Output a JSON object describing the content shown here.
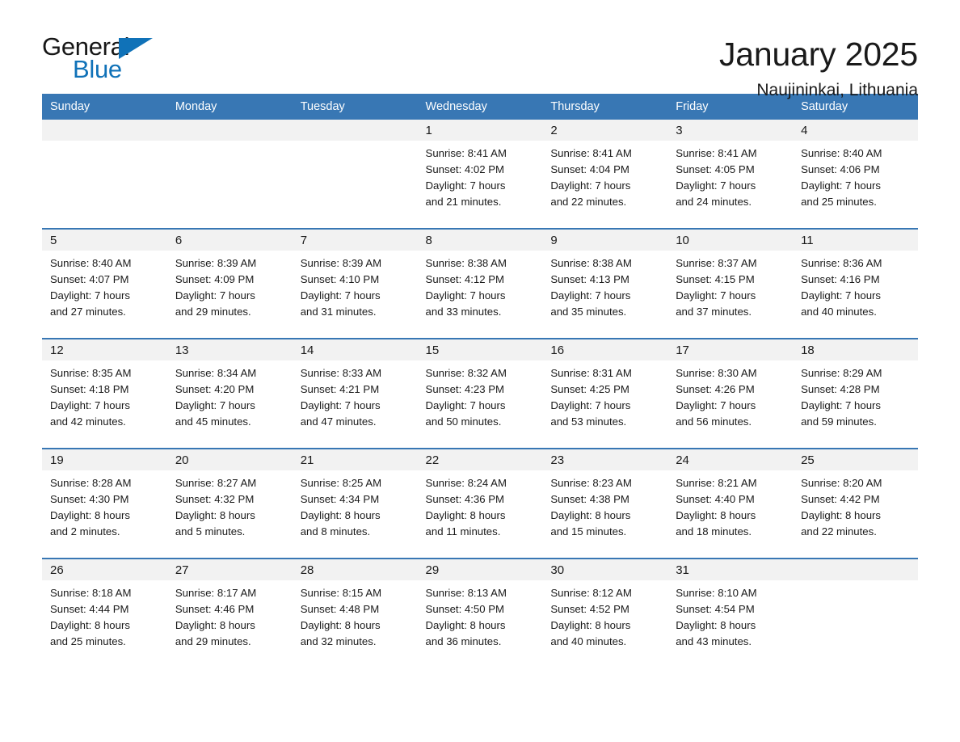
{
  "logo": {
    "word_one": "General",
    "word_two": "Blue",
    "triangle_color": "#1072b8"
  },
  "header": {
    "title": "January 2025",
    "subtitle": "Naujininkai, Lithuania"
  },
  "calendar": {
    "accent_color": "#3877b4",
    "weekday_headers": [
      "Sunday",
      "Monday",
      "Tuesday",
      "Wednesday",
      "Thursday",
      "Friday",
      "Saturday"
    ],
    "weeks": [
      [
        {
          "day": "",
          "lines": []
        },
        {
          "day": "",
          "lines": []
        },
        {
          "day": "",
          "lines": []
        },
        {
          "day": "1",
          "lines": [
            "Sunrise: 8:41 AM",
            "Sunset: 4:02 PM",
            "Daylight: 7 hours",
            "and 21 minutes."
          ]
        },
        {
          "day": "2",
          "lines": [
            "Sunrise: 8:41 AM",
            "Sunset: 4:04 PM",
            "Daylight: 7 hours",
            "and 22 minutes."
          ]
        },
        {
          "day": "3",
          "lines": [
            "Sunrise: 8:41 AM",
            "Sunset: 4:05 PM",
            "Daylight: 7 hours",
            "and 24 minutes."
          ]
        },
        {
          "day": "4",
          "lines": [
            "Sunrise: 8:40 AM",
            "Sunset: 4:06 PM",
            "Daylight: 7 hours",
            "and 25 minutes."
          ]
        }
      ],
      [
        {
          "day": "5",
          "lines": [
            "Sunrise: 8:40 AM",
            "Sunset: 4:07 PM",
            "Daylight: 7 hours",
            "and 27 minutes."
          ]
        },
        {
          "day": "6",
          "lines": [
            "Sunrise: 8:39 AM",
            "Sunset: 4:09 PM",
            "Daylight: 7 hours",
            "and 29 minutes."
          ]
        },
        {
          "day": "7",
          "lines": [
            "Sunrise: 8:39 AM",
            "Sunset: 4:10 PM",
            "Daylight: 7 hours",
            "and 31 minutes."
          ]
        },
        {
          "day": "8",
          "lines": [
            "Sunrise: 8:38 AM",
            "Sunset: 4:12 PM",
            "Daylight: 7 hours",
            "and 33 minutes."
          ]
        },
        {
          "day": "9",
          "lines": [
            "Sunrise: 8:38 AM",
            "Sunset: 4:13 PM",
            "Daylight: 7 hours",
            "and 35 minutes."
          ]
        },
        {
          "day": "10",
          "lines": [
            "Sunrise: 8:37 AM",
            "Sunset: 4:15 PM",
            "Daylight: 7 hours",
            "and 37 minutes."
          ]
        },
        {
          "day": "11",
          "lines": [
            "Sunrise: 8:36 AM",
            "Sunset: 4:16 PM",
            "Daylight: 7 hours",
            "and 40 minutes."
          ]
        }
      ],
      [
        {
          "day": "12",
          "lines": [
            "Sunrise: 8:35 AM",
            "Sunset: 4:18 PM",
            "Daylight: 7 hours",
            "and 42 minutes."
          ]
        },
        {
          "day": "13",
          "lines": [
            "Sunrise: 8:34 AM",
            "Sunset: 4:20 PM",
            "Daylight: 7 hours",
            "and 45 minutes."
          ]
        },
        {
          "day": "14",
          "lines": [
            "Sunrise: 8:33 AM",
            "Sunset: 4:21 PM",
            "Daylight: 7 hours",
            "and 47 minutes."
          ]
        },
        {
          "day": "15",
          "lines": [
            "Sunrise: 8:32 AM",
            "Sunset: 4:23 PM",
            "Daylight: 7 hours",
            "and 50 minutes."
          ]
        },
        {
          "day": "16",
          "lines": [
            "Sunrise: 8:31 AM",
            "Sunset: 4:25 PM",
            "Daylight: 7 hours",
            "and 53 minutes."
          ]
        },
        {
          "day": "17",
          "lines": [
            "Sunrise: 8:30 AM",
            "Sunset: 4:26 PM",
            "Daylight: 7 hours",
            "and 56 minutes."
          ]
        },
        {
          "day": "18",
          "lines": [
            "Sunrise: 8:29 AM",
            "Sunset: 4:28 PM",
            "Daylight: 7 hours",
            "and 59 minutes."
          ]
        }
      ],
      [
        {
          "day": "19",
          "lines": [
            "Sunrise: 8:28 AM",
            "Sunset: 4:30 PM",
            "Daylight: 8 hours",
            "and 2 minutes."
          ]
        },
        {
          "day": "20",
          "lines": [
            "Sunrise: 8:27 AM",
            "Sunset: 4:32 PM",
            "Daylight: 8 hours",
            "and 5 minutes."
          ]
        },
        {
          "day": "21",
          "lines": [
            "Sunrise: 8:25 AM",
            "Sunset: 4:34 PM",
            "Daylight: 8 hours",
            "and 8 minutes."
          ]
        },
        {
          "day": "22",
          "lines": [
            "Sunrise: 8:24 AM",
            "Sunset: 4:36 PM",
            "Daylight: 8 hours",
            "and 11 minutes."
          ]
        },
        {
          "day": "23",
          "lines": [
            "Sunrise: 8:23 AM",
            "Sunset: 4:38 PM",
            "Daylight: 8 hours",
            "and 15 minutes."
          ]
        },
        {
          "day": "24",
          "lines": [
            "Sunrise: 8:21 AM",
            "Sunset: 4:40 PM",
            "Daylight: 8 hours",
            "and 18 minutes."
          ]
        },
        {
          "day": "25",
          "lines": [
            "Sunrise: 8:20 AM",
            "Sunset: 4:42 PM",
            "Daylight: 8 hours",
            "and 22 minutes."
          ]
        }
      ],
      [
        {
          "day": "26",
          "lines": [
            "Sunrise: 8:18 AM",
            "Sunset: 4:44 PM",
            "Daylight: 8 hours",
            "and 25 minutes."
          ]
        },
        {
          "day": "27",
          "lines": [
            "Sunrise: 8:17 AM",
            "Sunset: 4:46 PM",
            "Daylight: 8 hours",
            "and 29 minutes."
          ]
        },
        {
          "day": "28",
          "lines": [
            "Sunrise: 8:15 AM",
            "Sunset: 4:48 PM",
            "Daylight: 8 hours",
            "and 32 minutes."
          ]
        },
        {
          "day": "29",
          "lines": [
            "Sunrise: 8:13 AM",
            "Sunset: 4:50 PM",
            "Daylight: 8 hours",
            "and 36 minutes."
          ]
        },
        {
          "day": "30",
          "lines": [
            "Sunrise: 8:12 AM",
            "Sunset: 4:52 PM",
            "Daylight: 8 hours",
            "and 40 minutes."
          ]
        },
        {
          "day": "31",
          "lines": [
            "Sunrise: 8:10 AM",
            "Sunset: 4:54 PM",
            "Daylight: 8 hours",
            "and 43 minutes."
          ]
        },
        {
          "day": "",
          "lines": []
        }
      ]
    ]
  }
}
